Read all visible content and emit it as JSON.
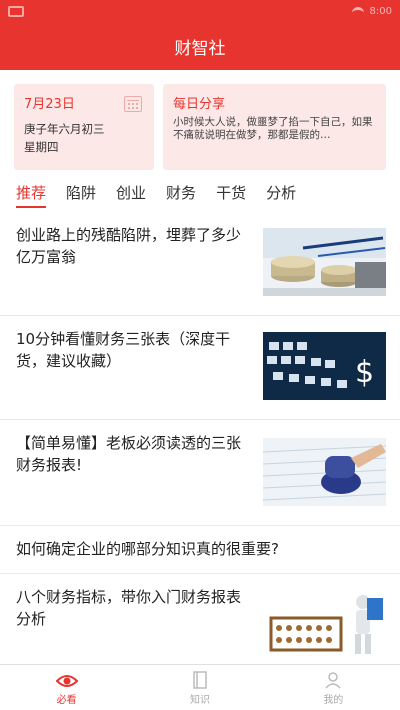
{
  "status_bar": {
    "time": "8:00"
  },
  "header": {
    "title": "财智社"
  },
  "date_card": {
    "date": "7月23日",
    "lunar": "庚子年六月初三",
    "weekday": "星期四"
  },
  "share_card": {
    "title": "每日分享",
    "text": "小时候大人说，做噩梦了掐一下自己，如果不痛就说明在做梦，那都是假的…"
  },
  "tabs": [
    "推荐",
    "陷阱",
    "创业",
    "财务",
    "干货",
    "分析"
  ],
  "articles": [
    {
      "title": "创业路上的残酷陷阱，埋葬了多少亿万富翁",
      "image": "coins-and-pens"
    },
    {
      "title": "10分钟看懂财务三张表（深度干货，建议收藏）",
      "image": "dollar-keyboard"
    },
    {
      "title": "【简单易懂】老板必须读透的三张财务报表!",
      "image": "stamp-on-document"
    },
    {
      "title": "如何确定企业的哪部分知识真的很重要?"
    },
    {
      "title": "八个财务指标，带你入门财务报表分析",
      "image": "abacus-figure"
    }
  ],
  "bottom_nav": [
    {
      "label": "必看",
      "icon": "eye-icon"
    },
    {
      "label": "知识",
      "icon": "book-icon"
    },
    {
      "label": "我的",
      "icon": "user-icon"
    }
  ],
  "colors": {
    "brand": "#e8342f",
    "card_bg": "#fde8e8"
  }
}
